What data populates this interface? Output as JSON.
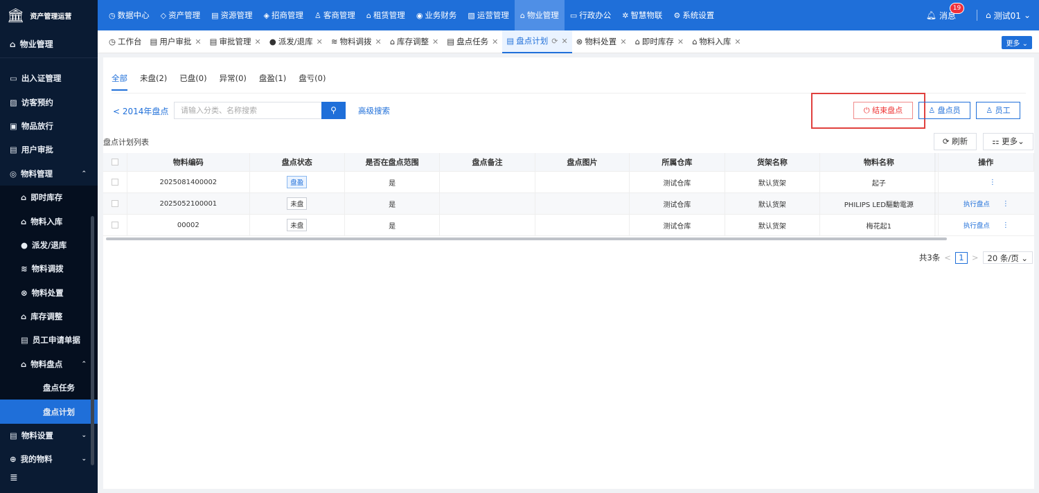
{
  "app": {
    "title": "资产管理运营",
    "logo_icon": "building-icon"
  },
  "topnav": [
    {
      "label": "数据中心",
      "icon": "◷"
    },
    {
      "label": "资产管理",
      "icon": "◇"
    },
    {
      "label": "资源管理",
      "icon": "▤"
    },
    {
      "label": "招商管理",
      "icon": "◈"
    },
    {
      "label": "客商管理",
      "icon": "♙"
    },
    {
      "label": "租赁管理",
      "icon": "⌂"
    },
    {
      "label": "业务财务",
      "icon": "◉"
    },
    {
      "label": "运营管理",
      "icon": "▧"
    },
    {
      "label": "物业管理",
      "icon": "⌂"
    },
    {
      "label": "行政办公",
      "icon": "▭"
    },
    {
      "label": "智慧物联",
      "icon": "✲"
    },
    {
      "label": "系统设置",
      "icon": "⚙"
    }
  ],
  "topnav_active": 8,
  "header": {
    "messages_label": "消息",
    "messages_count": "19",
    "user_label": "测试01"
  },
  "sidebar": {
    "title": "物业管理",
    "items": [
      {
        "label": "出入证管理",
        "icon": "▭"
      },
      {
        "label": "访客预约",
        "icon": "▨"
      },
      {
        "label": "物品放行",
        "icon": "▣"
      },
      {
        "label": "用户审批",
        "icon": "▤"
      },
      {
        "label": "物料管理",
        "icon": "◎",
        "chev": "⌃"
      }
    ],
    "sub_items": [
      {
        "label": "即时库存",
        "icon": "⌂"
      },
      {
        "label": "物料入库",
        "icon": "⌂"
      },
      {
        "label": "派发/退库",
        "icon": "●"
      },
      {
        "label": "物料调拨",
        "icon": "≋"
      },
      {
        "label": "物料处置",
        "icon": "⊗"
      },
      {
        "label": "库存调整",
        "icon": "⌂"
      },
      {
        "label": "员工申请单据",
        "icon": "▤"
      },
      {
        "label": "物料盘点",
        "icon": "⌂",
        "chev": "⌃"
      }
    ],
    "sub2_items": [
      {
        "label": "盘点任务"
      },
      {
        "label": "盘点计划"
      }
    ],
    "bottom_items": [
      {
        "label": "物料设置",
        "icon": "▤",
        "chev": "⌄"
      },
      {
        "label": "我的物料",
        "icon": "⊕",
        "chev": "⌄"
      }
    ],
    "collapse_icon": "≣"
  },
  "tabs": [
    {
      "label": "工作台",
      "icon": "◷"
    },
    {
      "label": "用户审批",
      "icon": "▤"
    },
    {
      "label": "审批管理",
      "icon": "▤"
    },
    {
      "label": "派发/退库",
      "icon": "●"
    },
    {
      "label": "物料调拨",
      "icon": "≋"
    },
    {
      "label": "库存调整",
      "icon": "⌂"
    },
    {
      "label": "盘点任务",
      "icon": "▤"
    },
    {
      "label": "盘点计划",
      "icon": "▤"
    },
    {
      "label": "物料处置",
      "icon": "⊗"
    },
    {
      "label": "即时库存",
      "icon": "⌂"
    },
    {
      "label": "物料入库",
      "icon": "⌂"
    }
  ],
  "tabs_more": "更多 ⌄",
  "filter_tabs": [
    "全部",
    "未盘(2)",
    "已盘(0)",
    "异常(0)",
    "盘盈(1)",
    "盘亏(0)"
  ],
  "back_label": "< 2014年盘点",
  "search": {
    "placeholder": "请输入分类、名称搜索",
    "advanced": "高级搜索"
  },
  "actions": {
    "end": "⏻ 结束盘点",
    "counter": "♙ 盘点员",
    "staff": "♙ 员工"
  },
  "list": {
    "title": "盘点计划列表",
    "refresh": "⟳ 刷新",
    "more": "⚏ 更多⌄"
  },
  "table": {
    "columns": [
      "物料编码",
      "盘点状态",
      "是否在盘点范围",
      "盘点备注",
      "盘点图片",
      "所属仓库",
      "货架名称",
      "物料名称",
      "操作"
    ],
    "rows": [
      {
        "code": "2025081400002",
        "status": "盘盈",
        "in_range": "是",
        "remark": "",
        "image": "",
        "warehouse": "测试仓库",
        "shelf": "默认货架",
        "name": "起子",
        "op": ""
      },
      {
        "code": "2025052100001",
        "status": "未盘",
        "in_range": "是",
        "remark": "",
        "image": "",
        "warehouse": "测试仓库",
        "shelf": "默认货架",
        "name": "PHILIPS LED驅動電源",
        "op": "执行盘点"
      },
      {
        "code": "00002",
        "status": "未盘",
        "in_range": "是",
        "remark": "",
        "image": "",
        "warehouse": "测试仓库",
        "shelf": "默认货架",
        "name": "梅花起1",
        "op": "执行盘点"
      }
    ]
  },
  "pager": {
    "total": "共3条",
    "prev": "<",
    "page": "1",
    "next": ">",
    "size": "20 条/页 ⌄"
  }
}
